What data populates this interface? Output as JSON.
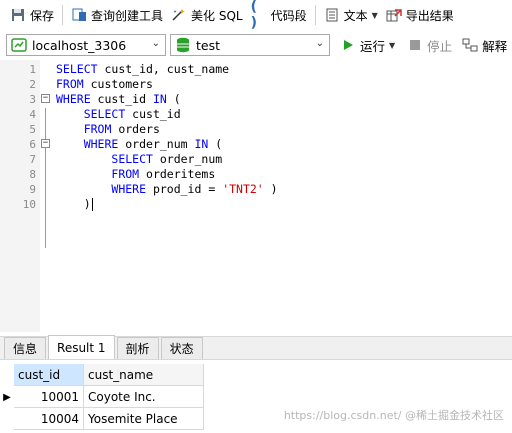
{
  "toolbar": {
    "save": "保存",
    "query_builder": "查询创建工具",
    "beautify_sql": "美化 SQL",
    "snippet": "代码段",
    "text": "文本",
    "export": "导出结果"
  },
  "connection_bar": {
    "connection": "localhost_3306",
    "database": "test",
    "run": "运行",
    "stop": "停止",
    "explain": "解释"
  },
  "editor": {
    "line_numbers": [
      "1",
      "2",
      "3",
      "4",
      "5",
      "6",
      "7",
      "8",
      "9",
      "10"
    ]
  },
  "bottom_tabs": [
    "信息",
    "Result 1",
    "剖析",
    "状态"
  ],
  "result": {
    "columns": [
      "cust_id",
      "cust_name"
    ],
    "rows": [
      {
        "cust_id": "10001",
        "cust_name": "Coyote Inc."
      },
      {
        "cust_id": "10004",
        "cust_name": "Yosemite Place"
      }
    ]
  },
  "watermark": "https://blog.csdn.net/  @稀土掘金技术社区",
  "colors": {
    "keyword": "#0000ff",
    "string": "#d10000",
    "run_green": "#22a122"
  },
  "icons": [
    "save-icon",
    "query-builder-icon",
    "beautify-icon",
    "snippet-icon",
    "text-icon",
    "export-icon",
    "connection-icon",
    "database-icon",
    "run-icon",
    "stop-icon",
    "explain-icon"
  ]
}
